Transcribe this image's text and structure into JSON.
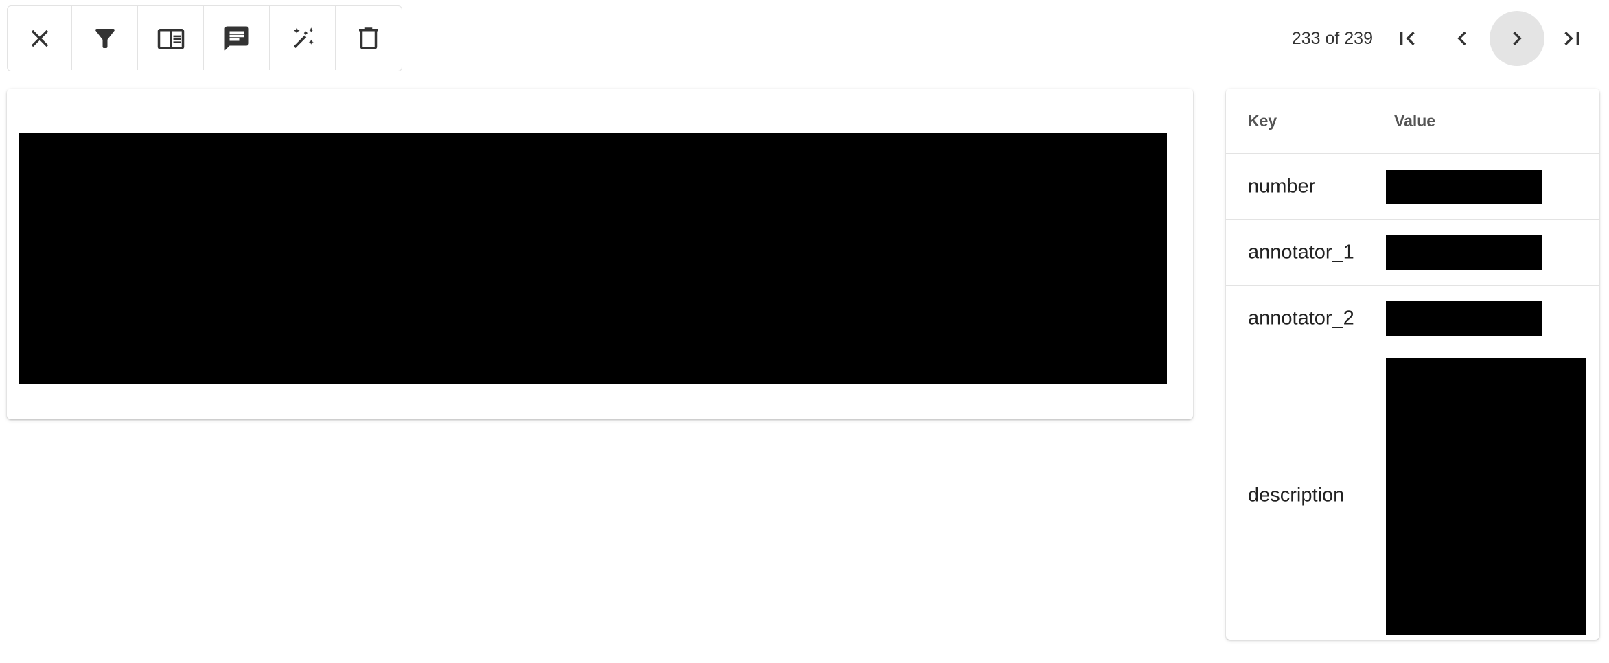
{
  "toolbar": {
    "buttons": [
      {
        "icon": "close-icon"
      },
      {
        "icon": "filter-icon"
      },
      {
        "icon": "sidebar-panel-icon"
      },
      {
        "icon": "comment-icon"
      },
      {
        "icon": "magic-wand-icon"
      },
      {
        "icon": "trash-icon"
      }
    ]
  },
  "pager": {
    "count_text": "233 of 239",
    "current": 233,
    "total": 239
  },
  "kv_table": {
    "header_key": "Key",
    "header_value": "Value",
    "rows": [
      {
        "key": "number"
      },
      {
        "key": "annotator_1"
      },
      {
        "key": "annotator_2"
      },
      {
        "key": "description"
      }
    ]
  }
}
